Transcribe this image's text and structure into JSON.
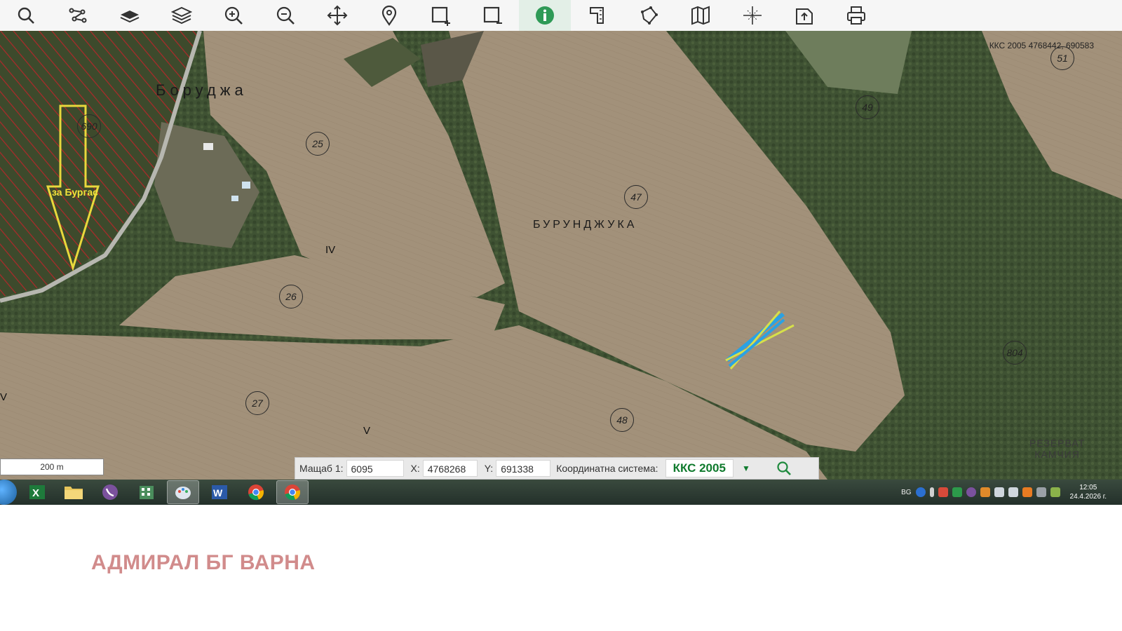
{
  "toolbar": {
    "buttons": [
      {
        "name": "search-icon"
      },
      {
        "name": "route-icon"
      },
      {
        "name": "layer-icon"
      },
      {
        "name": "layers-icon"
      },
      {
        "name": "zoom-in-icon"
      },
      {
        "name": "zoom-out-icon"
      },
      {
        "name": "pan-icon"
      },
      {
        "name": "pin-icon"
      },
      {
        "name": "add-rect-icon"
      },
      {
        "name": "remove-rect-icon"
      },
      {
        "name": "info-icon",
        "active": true
      },
      {
        "name": "measure-icon"
      },
      {
        "name": "polygon-icon"
      },
      {
        "name": "map-icon"
      },
      {
        "name": "crosshair-icon"
      },
      {
        "name": "export-icon"
      },
      {
        "name": "print-icon"
      }
    ]
  },
  "map": {
    "coord_readout": "ККС 2005 4768442, 690583",
    "labels": {
      "village": "Боруджа",
      "area": "БУРУНДЖУКА",
      "reserve": "РЕЗЕРВАТ\nКАМЧИЯ",
      "direction": "за Бургас"
    },
    "parcels": [
      "25",
      "26",
      "27",
      "47",
      "48",
      "49",
      "51",
      "690",
      "804"
    ],
    "roman": [
      "IV",
      "V",
      "V"
    ]
  },
  "scale": {
    "label": "200 m"
  },
  "coordbar": {
    "scale_label": "Мащаб 1:",
    "scale_value": "6095",
    "x_label": "X:",
    "x_value": "4768268",
    "y_label": "Y:",
    "y_value": "691338",
    "crs_label": "Координатна система:",
    "crs_value": "ККС 2005"
  },
  "taskbar": {
    "apps": [
      "excel-icon",
      "folder-icon",
      "viber-icon",
      "building-app-icon",
      "paint-icon",
      "word-icon",
      "chrome-icon",
      "chrome-icon-2"
    ],
    "lang": "BG",
    "time": "12:05",
    "date": "24.4.2026 г."
  },
  "footer": {
    "text": "АДМИРАЛ БГ ВАРНА"
  }
}
